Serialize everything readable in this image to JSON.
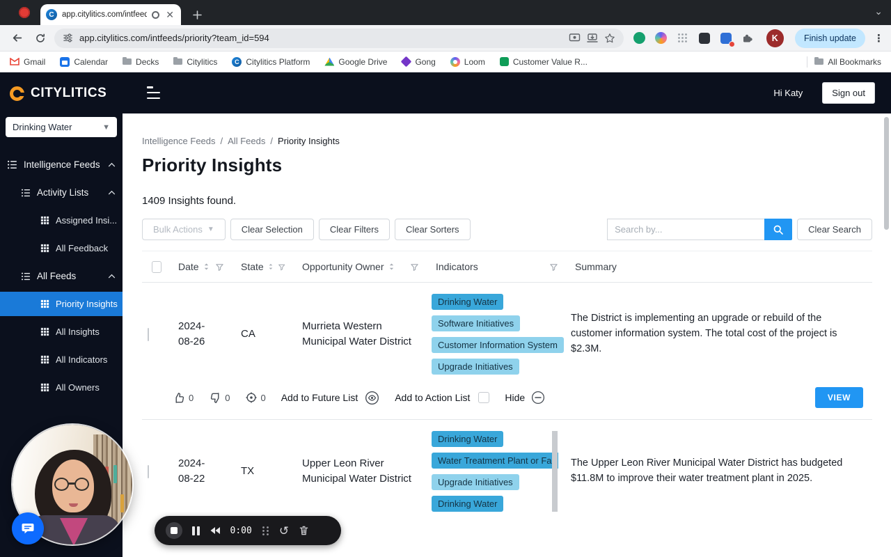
{
  "colors": {
    "accent_blue": "#2196f3",
    "sidebar_navy": "#0b101d",
    "chip_dark": "#39a7da",
    "chip_light": "#8fd2ec",
    "logo_orange": "#f59a23",
    "update_pill": "#c2e7ff",
    "chat_blue": "#0d6bff",
    "record_red": "#e23c36"
  },
  "browser": {
    "tab_title": "app.citylitics.com/intfeed...",
    "url": "app.citylitics.com/intfeeds/priority?team_id=594",
    "profile_initial": "K",
    "update_label": "Finish update",
    "bookmarks": [
      "Gmail",
      "Calendar",
      "Decks",
      "Citylitics",
      "Citylitics Platform",
      "Google Drive",
      "Gong",
      "Loom",
      "Customer Value R...",
      "All Bookmarks"
    ]
  },
  "sidebar": {
    "logo": "CITYLITICS",
    "context_select": "Drinking Water",
    "items": [
      {
        "label": "Intelligence Feeds"
      },
      {
        "label": "Activity Lists"
      },
      {
        "label": "Assigned Insi..."
      },
      {
        "label": "All Feedback"
      },
      {
        "label": "All Feeds"
      },
      {
        "label": "Priority Insights"
      },
      {
        "label": "All Insights"
      },
      {
        "label": "All Indicators"
      },
      {
        "label": "All Owners"
      }
    ]
  },
  "header": {
    "greeting": "Hi Katy",
    "signout": "Sign out"
  },
  "main": {
    "breadcrumb": [
      "Intelligence Feeds",
      "All Feeds",
      "Priority Insights"
    ],
    "breadcrumb_sep": "/",
    "title": "Priority Insights",
    "count": "1409 Insights found.",
    "toolbar": {
      "bulk_actions": "Bulk Actions",
      "clear_selection": "Clear Selection",
      "clear_filters": "Clear Filters",
      "clear_sorters": "Clear Sorters",
      "search_placeholder": "Search by...",
      "clear_search": "Clear Search"
    },
    "table": {
      "headers": {
        "date": "Date",
        "state": "State",
        "owner": "Opportunity Owner",
        "indicators": "Indicators",
        "summary": "Summary"
      },
      "row_actions": {
        "add_future": "Add to Future List",
        "add_action": "Add to Action List",
        "hide": "Hide",
        "view": "VIEW"
      },
      "rows": [
        {
          "date": "2024-08-26",
          "state": "CA",
          "owner": "Murrieta Western Municipal Water District",
          "indicators": [
            "Drinking Water",
            "Software Initiatives",
            "Customer Information System",
            "Upgrade Initiatives"
          ],
          "summary": "The District is implementing an upgrade or rebuild of the customer information system. The total cost of the project is $2.3M.",
          "upvotes": "0",
          "downvotes": "0",
          "locations": "0"
        },
        {
          "date": "2024-08-22",
          "state": "TX",
          "owner": "Upper Leon River Municipal Water District",
          "indicators": [
            "Drinking Water",
            "Water Treatment Plant or Fac",
            "Upgrade Initiatives",
            "Drinking Water"
          ],
          "summary": "The Upper Leon River Municipal Water District has budgeted $11.8M to improve their water treatment plant in 2025."
        }
      ]
    }
  },
  "recorder": {
    "time": "0:00"
  }
}
